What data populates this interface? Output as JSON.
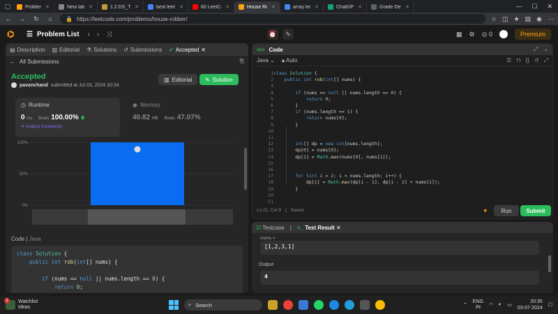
{
  "browser": {
    "tabs": [
      {
        "label": "Problems - L",
        "color": "#ffa116",
        "active": false
      },
      {
        "label": "New tab",
        "color": "#888888",
        "active": false
      },
      {
        "label": "1.2 DS_Time",
        "color": "#c19a3a",
        "active": false
      },
      {
        "label": "best leetcod",
        "color": "#4285f4",
        "active": false
      },
      {
        "label": "60 LeetCode",
        "color": "#ff0000",
        "active": false
      },
      {
        "label": "House Robbe",
        "color": "#ffa116",
        "active": true
      },
      {
        "label": "array length",
        "color": "#4285f4",
        "active": false
      },
      {
        "label": "ChatGPT",
        "color": "#10a37f",
        "active": false
      },
      {
        "label": "Grade Detai",
        "color": "#5f6368",
        "active": false
      }
    ],
    "url": "https://leetcode.com/problems/house-robber/"
  },
  "header": {
    "problem_list": "Problem List",
    "coins": "0",
    "premium": "Premium"
  },
  "left": {
    "tabs": [
      "Description",
      "Editorial",
      "Solutions",
      "Submissions",
      "Accepted"
    ],
    "all_submissions": "All Submissions",
    "status": "Accepted",
    "user": "pavanchand",
    "submitted_at": "submitted at Jul 03, 2024 20:34",
    "editorial_btn": "Editorial",
    "solution_btn": "Solution",
    "runtime_label": "Runtime",
    "runtime_value": "0",
    "runtime_unit": "ms",
    "runtime_beats_label": "Beats",
    "runtime_beats": "100.00%",
    "analyze": "Analyze Complexity",
    "memory_label": "Memory",
    "memory_value": "40.82",
    "memory_unit": "MB",
    "memory_beats_label": "Beats",
    "memory_beats": "47.07%",
    "code_label": "Code",
    "code_lang": "Java",
    "code_lines": [
      "class Solution {",
      "    public int rob(int[] nums) {",
      "",
      "        if (nums == null || nums.length == 0) {",
      "            return 0;",
      "        }"
    ]
  },
  "chart_data": {
    "type": "bar",
    "categories": [
      "0ms"
    ],
    "values": [
      100
    ],
    "ylim": [
      0,
      100
    ],
    "yticks": [
      "100%",
      "50%",
      "0%"
    ],
    "bar_color": "#0a6cf0",
    "grid": true
  },
  "editor": {
    "title": "Code",
    "language": "Java",
    "mode": "Auto",
    "code": [
      "class Solution {",
      "    public int rob(int[] nums) {",
      "",
      "        if (nums == null || nums.length == 0) {",
      "            return 0;",
      "        }",
      "        if (nums.length == 1) {",
      "            return nums[0];",
      "        }",
      "",
      "",
      "        int[] dp = new int[nums.length];",
      "        dp[0] = nums[0];",
      "        dp[1] = Math.max(nums[0], nums[1]);",
      "",
      "",
      "        for (int i = 2; i < nums.length; i++) {",
      "            dp[i] = Math.max(dp[i - 1], dp[i - 2] + nums[i]);",
      "        }",
      "",
      ""
    ],
    "status": "Ln 21, Col 9",
    "saved": "Saved",
    "run": "Run",
    "submit": "Submit"
  },
  "test": {
    "tab1": "Testcase",
    "tab2": "Test Result",
    "input_label": "nums =",
    "input_value": "[1,2,3,1]",
    "output_label": "Output",
    "output_value": "4"
  },
  "taskbar": {
    "weather1": "Watchlist",
    "weather2": "Ideas",
    "search": "Search",
    "lang1": "ENG",
    "lang2": "IN",
    "time": "20:35",
    "date": "03-07-2024"
  }
}
